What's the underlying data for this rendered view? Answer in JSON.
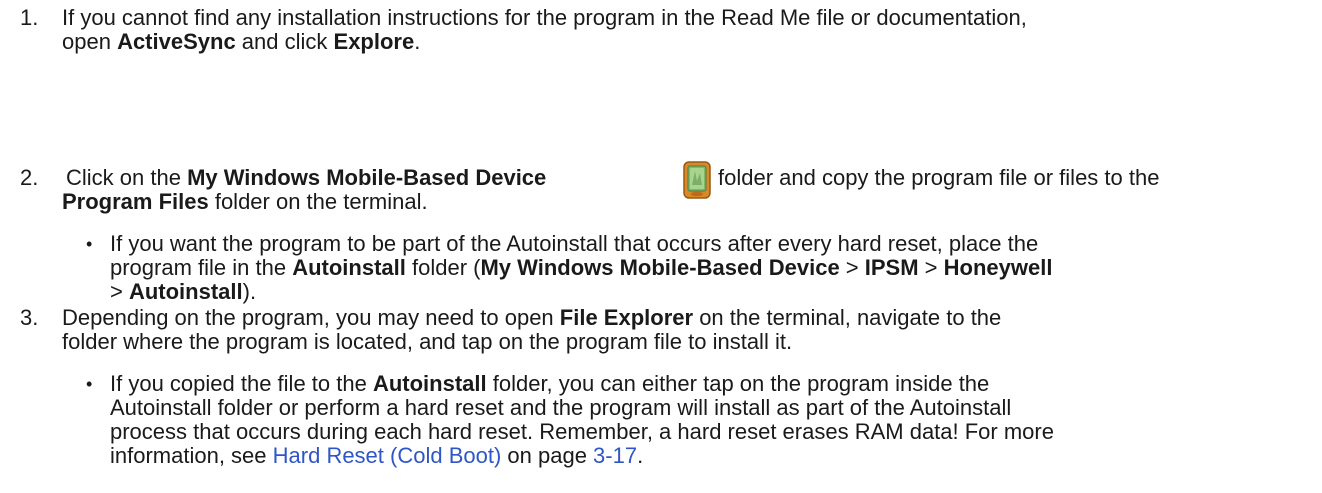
{
  "steps": [
    {
      "number": "1.",
      "lines": [
        "If you cannot find any installation instructions for the program in the Read Me file or documentation,"
      ],
      "line2_pre": "open ",
      "line2_b1": "ActiveSync",
      "line2_mid": " and click ",
      "line2_b2": "Explore",
      "line2_post": "."
    },
    {
      "number": "2.",
      "line1_pre": "Click on the ",
      "line1_b1": "My Windows Mobile-Based Device",
      "icon": "windows-mobile-device-icon",
      "line1_post": " folder and copy the program file or files to the",
      "line2_b1": "Program Files",
      "line2_post": " folder on the terminal.",
      "bullet": {
        "glyph": "•",
        "line1": "If you want the program to be part of the Autoinstall that occurs after every hard reset, place the",
        "line2_pre": "program file in the ",
        "line2_b1": "Autoinstall",
        "line2_mid1": " folder (",
        "line2_b2": "My Windows Mobile-Based Device",
        "line2_mid2": " > ",
        "line2_b3": "IPSM",
        "line2_mid3": " > ",
        "line2_b4": "Honeywell",
        "line3_pre": "> ",
        "line3_b1": "Autoinstall",
        "line3_post": ")."
      }
    },
    {
      "number": "3.",
      "line1_pre": "Depending on the program, you may need to open ",
      "line1_b1": "File Explorer",
      "line1_post": " on the terminal, navigate to the",
      "line2": "folder where the program is located, and tap on the program file to install it.",
      "bullet": {
        "glyph": "•",
        "line1_pre": "If you copied the file to the ",
        "line1_b1": "Autoinstall",
        "line1_post": " folder, you can either tap on the program inside the",
        "line2": "Autoinstall folder or perform a hard reset and the program will install as part of the Autoinstall",
        "line3": "process that occurs during each hard reset. Remember, a hard reset erases RAM data! For more",
        "line4_pre": "information, see ",
        "line4_link": "Hard Reset (Cold Boot)",
        "line4_mid": " on page ",
        "line4_page": "3-17",
        "line4_post": "."
      }
    }
  ],
  "colors": {
    "link": "#2f56c6",
    "text": "#1a1a1a"
  }
}
